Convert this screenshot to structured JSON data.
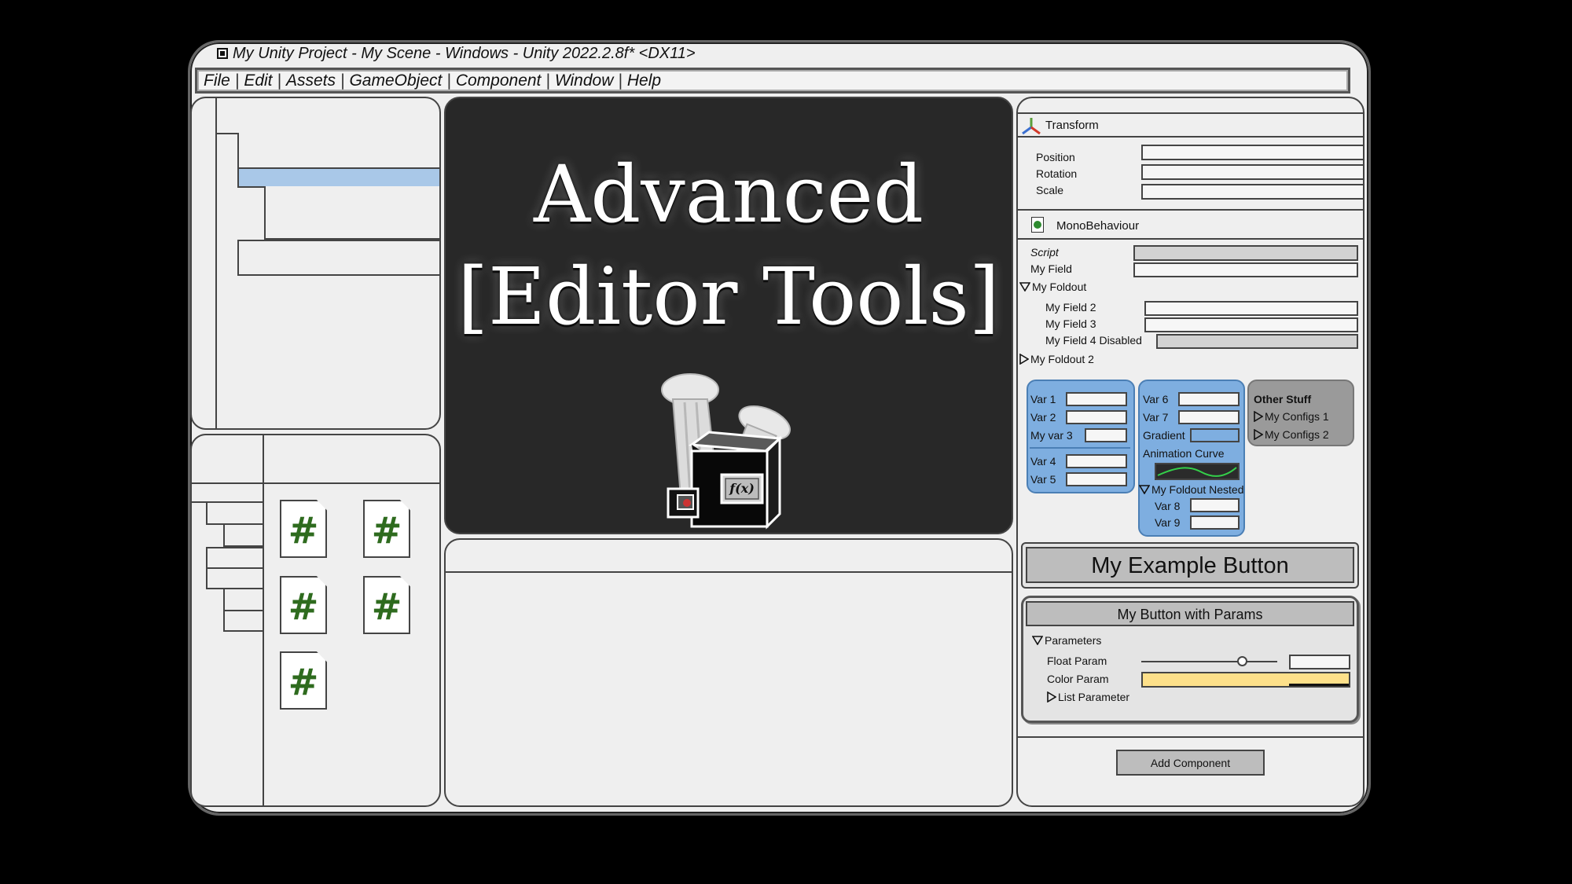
{
  "window": {
    "title": "My Unity Project - My Scene - Windows - Unity 2022.2.8f* <DX11>"
  },
  "menu": {
    "items": [
      "File",
      "Edit",
      "Assets",
      "GameObject",
      "Component",
      "Window",
      "Help"
    ],
    "separator": "|"
  },
  "scene": {
    "headline_line1": "Advanced",
    "headline_line2": "[Editor Tools]",
    "logo_label": "f(x)"
  },
  "project": {
    "file_icon_glyph": "#",
    "file_count": 5
  },
  "inspector": {
    "transform": {
      "header": "Transform",
      "fields": [
        "Position",
        "Rotation",
        "Scale"
      ]
    },
    "mono": {
      "header": "MonoBehaviour",
      "script_label": "Script",
      "my_field": "My Field",
      "foldout": "My Foldout",
      "field2": "My Field 2",
      "field3": "My Field 3",
      "field4": "My Field 4 Disabled",
      "foldout2": "My Foldout 2"
    },
    "group1": {
      "var1": "Var 1",
      "var2": "Var 2",
      "var3": "My var 3",
      "var4": "Var 4",
      "var5": "Var 5"
    },
    "group2": {
      "var6": "Var 6",
      "var7": "Var 7",
      "gradient": "Gradient",
      "anim_curve": "Animation Curve",
      "nested": "My Foldout Nested",
      "var8": "Var 8",
      "var9": "Var 9"
    },
    "group3": {
      "title": "Other Stuff",
      "config1": "My Configs 1",
      "config2": "My Configs 2"
    },
    "example_button": "My Example Button",
    "params_button": "My Button with Params",
    "params": {
      "header": "Parameters",
      "float_param": "Float Param",
      "float_value": 0.74,
      "color_param": "Color Param",
      "color_value": "#fde08a",
      "list_param": "List Parameter"
    },
    "add_component": "Add Component"
  },
  "colors": {
    "selection": "#a9c8e8",
    "group_blue": "#7eaee0",
    "group_gray": "#9a9a9a",
    "hash_green": "#2e6b1e",
    "scene_bg": "#282828"
  }
}
